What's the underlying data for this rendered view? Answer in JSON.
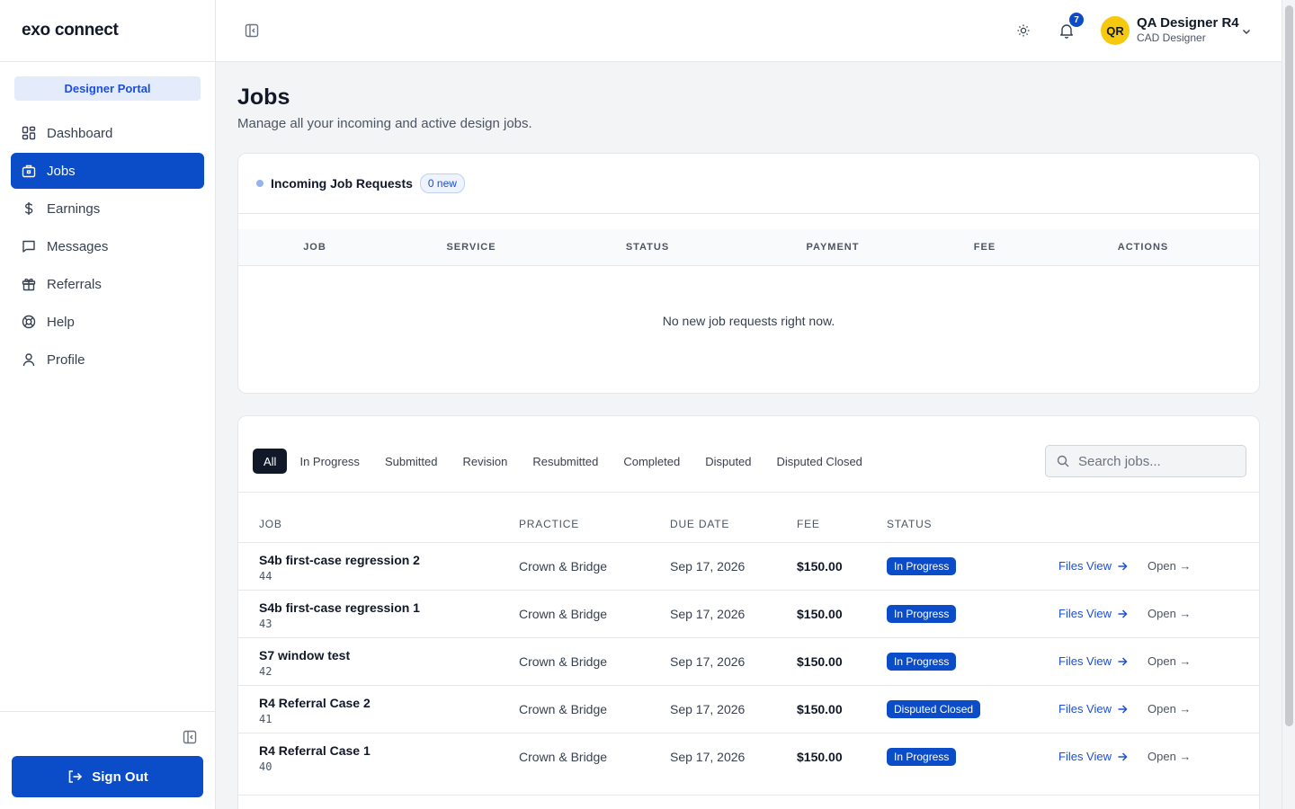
{
  "brand": {
    "logo": "exo connect",
    "portal": "Designer Portal"
  },
  "sidebar": {
    "items": [
      {
        "label": "Dashboard",
        "icon": "dashboard-icon"
      },
      {
        "label": "Jobs",
        "icon": "briefcase-icon"
      },
      {
        "label": "Earnings",
        "icon": "dollar-icon"
      },
      {
        "label": "Messages",
        "icon": "message-icon"
      },
      {
        "label": "Referrals",
        "icon": "gift-icon"
      },
      {
        "label": "Help",
        "icon": "lifebuoy-icon"
      },
      {
        "label": "Profile",
        "icon": "user-icon"
      }
    ],
    "active_index": 1,
    "signout_label": "Sign Out"
  },
  "topbar": {
    "notifications_count": "7",
    "user": {
      "initials": "QR",
      "name": "QA Designer R4",
      "role": "CAD Designer"
    }
  },
  "page": {
    "title": "Jobs",
    "subtitle": "Manage all your incoming and active design jobs."
  },
  "requests": {
    "title": "Incoming Job Requests",
    "badge": "0 new",
    "columns": [
      "JOB",
      "SERVICE",
      "STATUS",
      "PAYMENT",
      "FEE",
      "ACTIONS"
    ],
    "empty_text": "No new job requests right now."
  },
  "jobs": {
    "filters": [
      "All",
      "In Progress",
      "Submitted",
      "Revision",
      "Resubmitted",
      "Completed",
      "Disputed",
      "Disputed Closed"
    ],
    "active_filter": "All",
    "search_placeholder": "Search jobs...",
    "columns": {
      "job": "JOB",
      "practice": "PRACTICE",
      "due": "DUE DATE",
      "fee": "FEE",
      "status": "STATUS"
    },
    "files_label": "Files View",
    "open_label": "Open →",
    "rows": [
      {
        "name": "S4b first-case regression 2",
        "id": "44",
        "practice": "Crown & Bridge",
        "due": "Sep 17, 2026",
        "fee": "$150.00",
        "status": "In Progress"
      },
      {
        "name": "S4b first-case regression 1",
        "id": "43",
        "practice": "Crown & Bridge",
        "due": "Sep 17, 2026",
        "fee": "$150.00",
        "status": "In Progress"
      },
      {
        "name": "S7 window test",
        "id": "42",
        "practice": "Crown & Bridge",
        "due": "Sep 17, 2026",
        "fee": "$150.00",
        "status": "In Progress"
      },
      {
        "name": "R4 Referral Case 2",
        "id": "41",
        "practice": "Crown & Bridge",
        "due": "Sep 17, 2026",
        "fee": "$150.00",
        "status": "Disputed Closed"
      },
      {
        "name": "R4 Referral Case 1",
        "id": "40",
        "practice": "Crown & Bridge",
        "due": "Sep 17, 2026",
        "fee": "$150.00",
        "status": "In Progress"
      }
    ]
  },
  "colors": {
    "accent": "#0b4cc9",
    "accent_soft": "#e4ecfb",
    "avatar": "#f6c90e",
    "background": "#f3f4f6"
  }
}
